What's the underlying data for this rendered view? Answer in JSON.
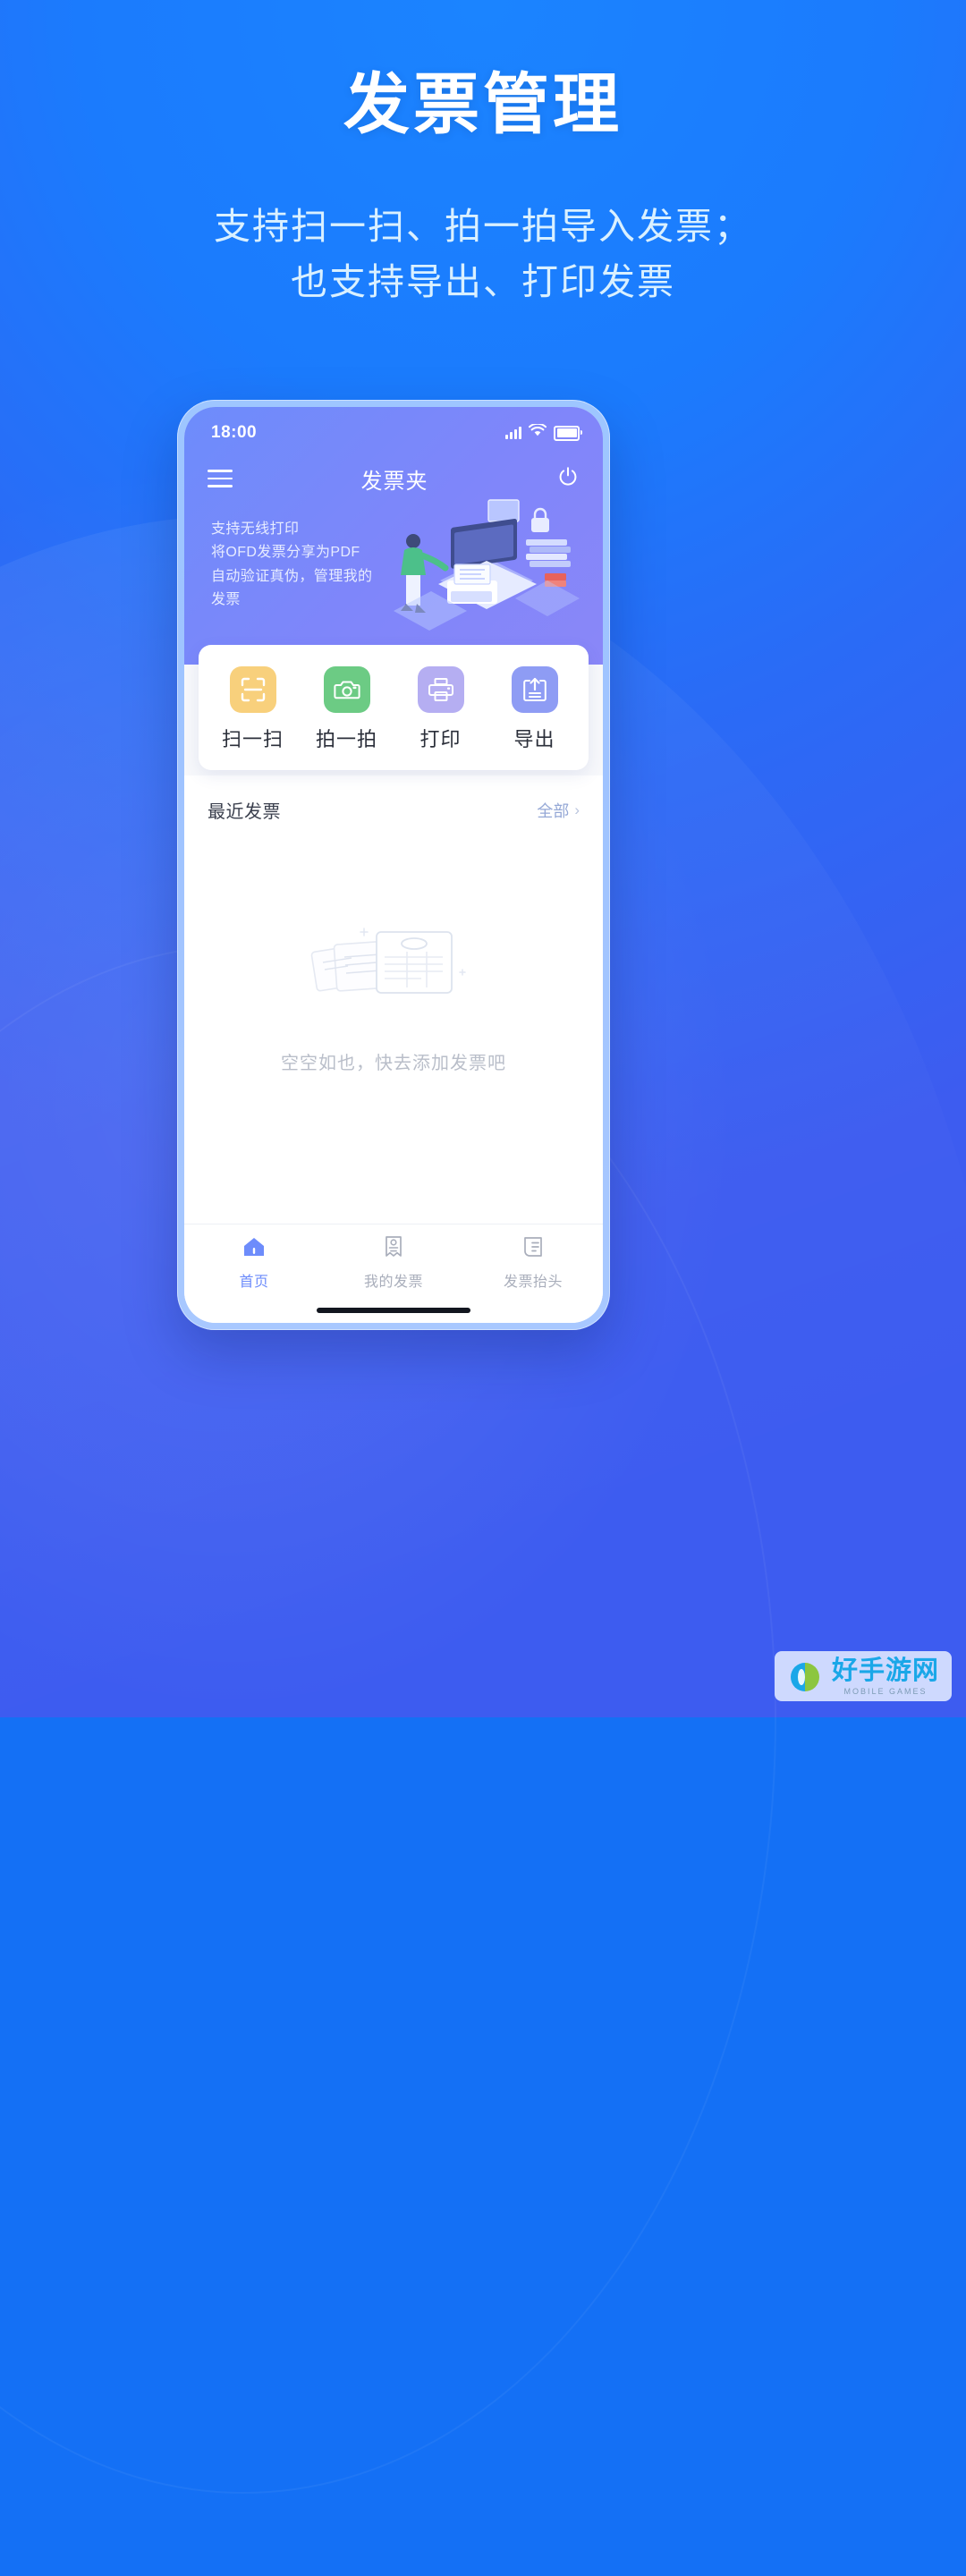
{
  "page": {
    "title": "发票管理",
    "subtitle_line1": "支持扫一扫、拍一拍导入发票；",
    "subtitle_line2": "也支持导出、打印发票",
    "bg_color": "#1b7bfd",
    "accent_color": "#6d8cfb"
  },
  "phone": {
    "status": {
      "time": "18:00",
      "signal_icon": "signal-bars-icon",
      "wifi_icon": "wifi-icon",
      "battery_icon": "battery-icon"
    },
    "navbar": {
      "menu_icon": "hamburger-menu-icon",
      "title": "发票夹",
      "power_icon": "power-icon"
    },
    "banner": {
      "line1": "支持无线打印",
      "line2": "将OFD发票分享为PDF",
      "line3": "自动验证真伪，管理我的发票",
      "illustration": "desk-workspace-illustration"
    },
    "actions": [
      {
        "label": "扫一扫",
        "icon": "scan-icon",
        "bg": "#f8d07c",
        "fg": "#ffffff"
      },
      {
        "label": "拍一拍",
        "icon": "camera-icon",
        "bg": "#6ccb84",
        "fg": "#ffffff"
      },
      {
        "label": "打印",
        "icon": "printer-icon",
        "bg": "#b5aef2",
        "fg": "#ffffff"
      },
      {
        "label": "导出",
        "icon": "export-icon",
        "bg": "#8e9cf4",
        "fg": "#ffffff"
      }
    ],
    "recent": {
      "title": "最近发票",
      "all_label": "全部",
      "chevron_icon": "chevron-right-icon",
      "empty_text": "空空如也，快去添加发票吧",
      "empty_illustration": "empty-invoice-cards-illustration"
    },
    "tabs": [
      {
        "label": "首页",
        "icon": "home-icon",
        "active": true
      },
      {
        "label": "我的发票",
        "icon": "invoice-receipt-icon",
        "active": false
      },
      {
        "label": "发票抬头",
        "icon": "invoice-title-icon",
        "active": false
      }
    ]
  },
  "watermark": {
    "name": "好手游网",
    "tagline": "MOBILE GAMES"
  }
}
